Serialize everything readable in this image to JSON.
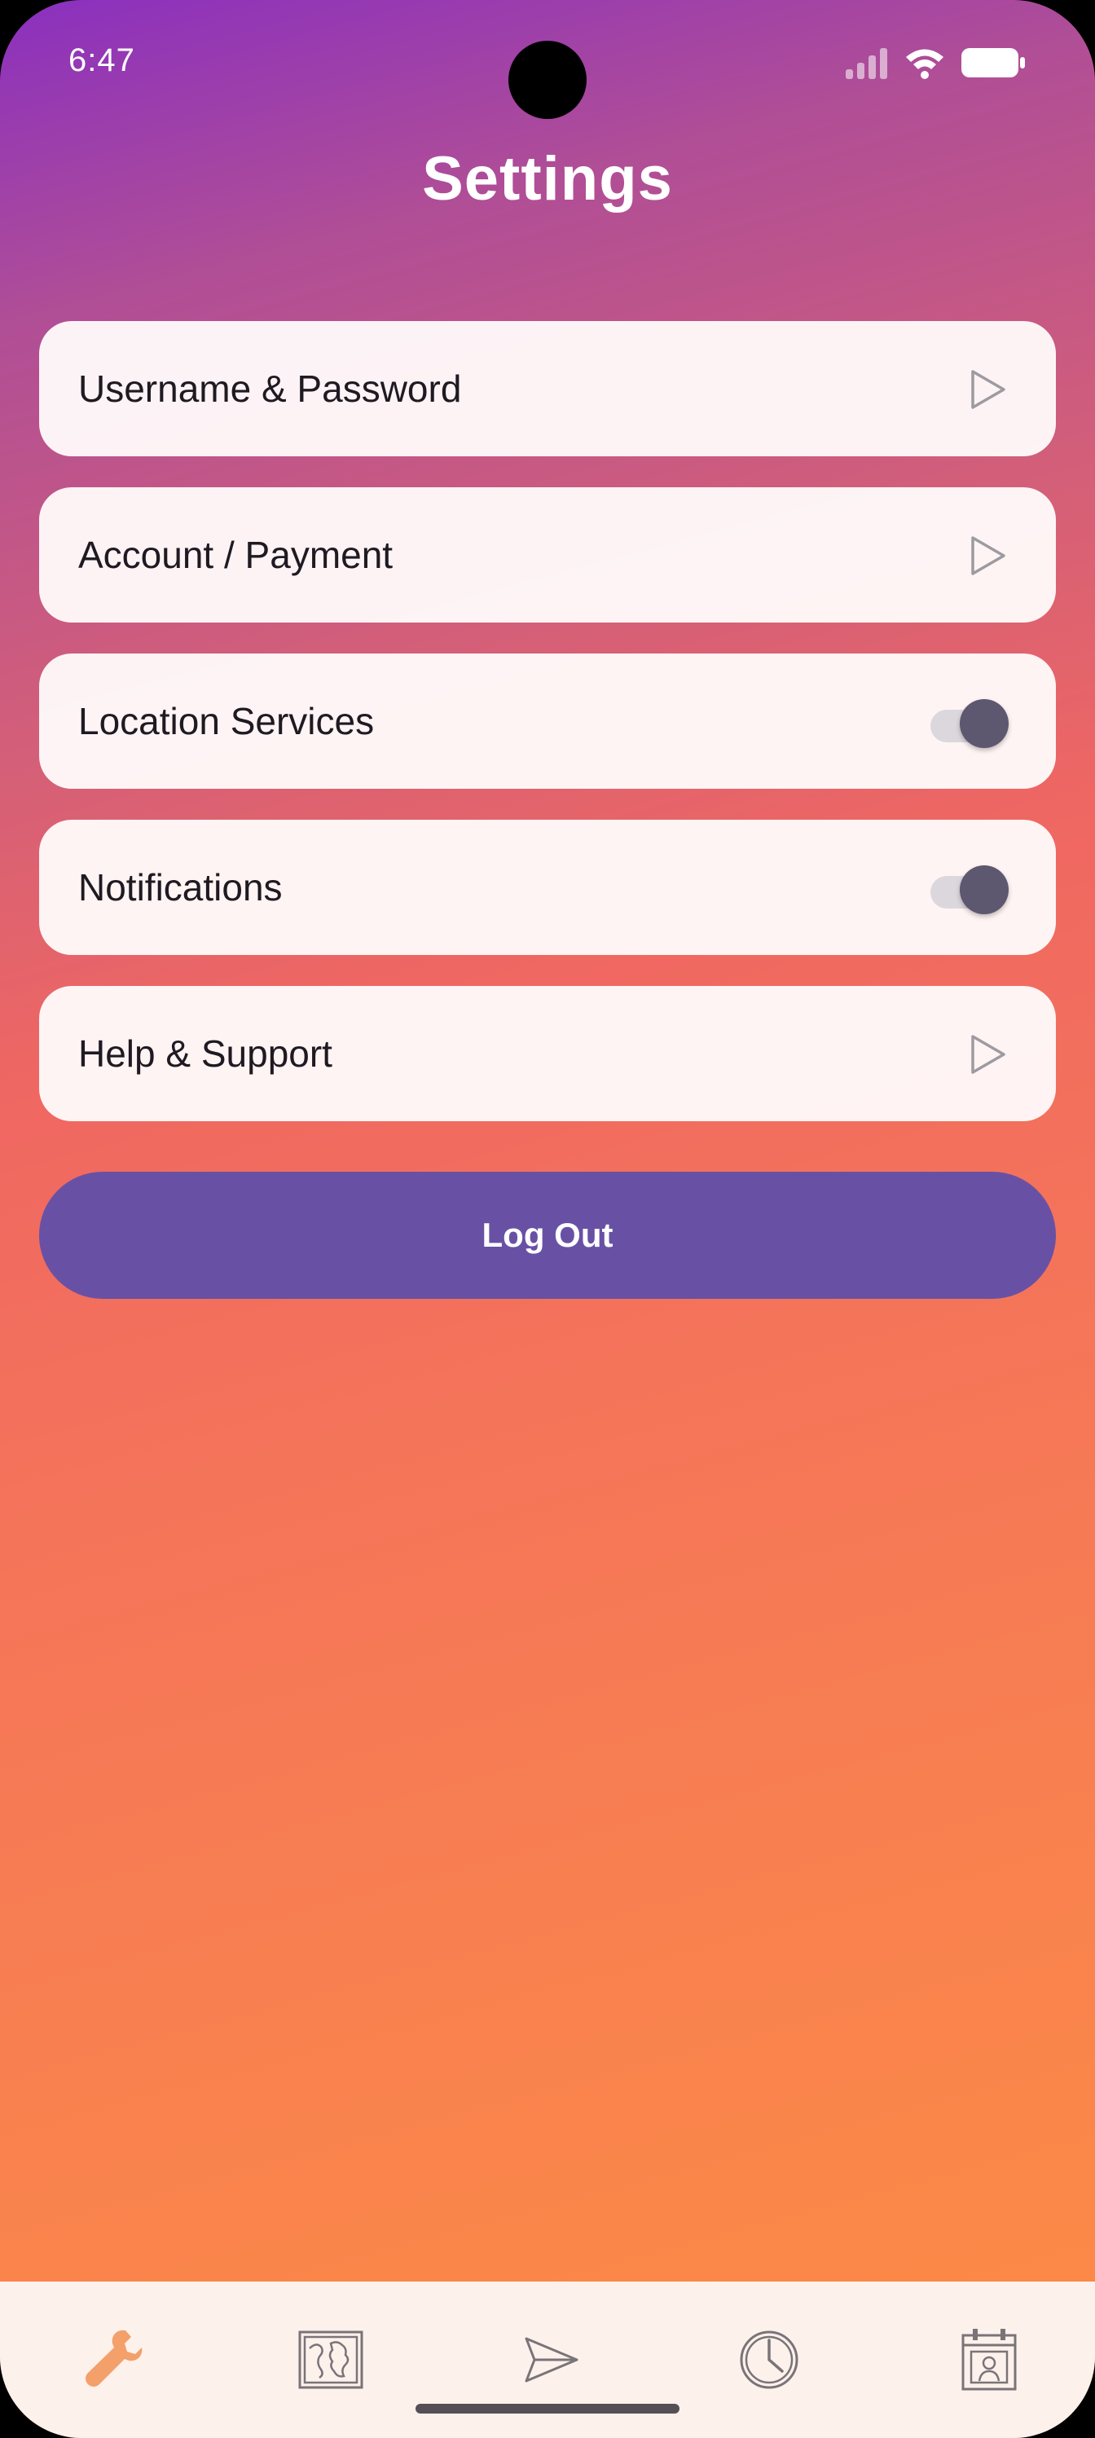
{
  "status_bar": {
    "time": "6:47",
    "icons": [
      "signal-icon",
      "wifi-icon",
      "battery-icon"
    ]
  },
  "header": {
    "title": "Settings"
  },
  "settings": {
    "items": [
      {
        "label": "Username & Password",
        "control": "arrow"
      },
      {
        "label": "Account / Payment",
        "control": "arrow"
      },
      {
        "label": "Location Services",
        "control": "toggle",
        "on": true
      },
      {
        "label": "Notifications",
        "control": "toggle",
        "on": true
      },
      {
        "label": "Help & Support",
        "control": "arrow"
      }
    ]
  },
  "logout": {
    "label": "Log Out"
  },
  "bottom_nav": {
    "items": [
      {
        "icon": "wrench-icon",
        "active": true
      },
      {
        "icon": "map-icon",
        "active": false
      },
      {
        "icon": "send-icon",
        "active": false
      },
      {
        "icon": "clock-icon",
        "active": false
      },
      {
        "icon": "calendar-contact-icon",
        "active": false
      }
    ]
  },
  "colors": {
    "accent_purple": "#6851a4",
    "active_nav": "#f4a06a",
    "inactive_nav": "#7a7478",
    "gradient_top": "#8a30bf",
    "gradient_bottom": "#fd8c44"
  }
}
